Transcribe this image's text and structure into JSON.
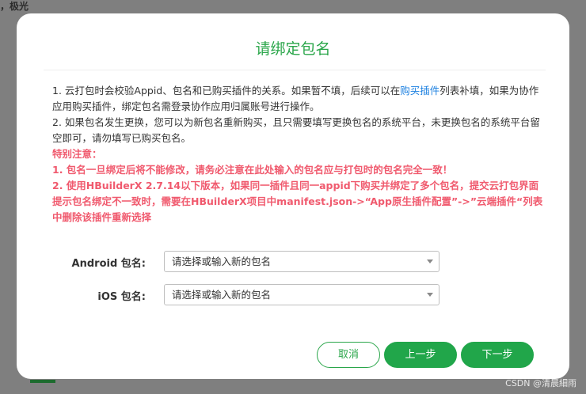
{
  "background": {
    "corner_text": "，极光",
    "watermark": "CSDN @清晨細雨"
  },
  "dialog": {
    "title": "请绑定包名",
    "notice": {
      "line1_pre": "1. 云打包时会校验Appid、包名和已购买插件的关系。如果暂不填，后续可以在",
      "line1_link": "购买插件",
      "line1_post": "列表补填，如果为协作应用购买插件，绑定包名需登录协作应用归属账号进行操作。",
      "line2": "2. 如果包名发生更换，您可以为新包名重新购买，且只需要填写更换包名的系统平台，未更换包名的系统平台留空即可，请勿填写已购买包名。",
      "warn_title": "特别注意：",
      "warn1": "1. 包名一旦绑定后将不能修改，请务必注意在此处输入的包名应与打包时的包名完全一致！",
      "warn2": "2. 使用HBuilderX 2.7.14以下版本，如果同一插件且同一appid下购买并绑定了多个包名，提交云打包界面提示包名绑定不一致时，需要在HBuilderX项目中manifest.json->“App原生插件配置”->”云端插件“列表中删除该插件重新选择"
    },
    "form": {
      "android_label": "Android 包名:",
      "android_value": "请选择或输入新的包名",
      "ios_label": "iOS 包名:",
      "ios_value": "请选择或输入新的包名"
    },
    "buttons": {
      "cancel": "取消",
      "prev": "上一步",
      "next": "下一步"
    }
  },
  "colors": {
    "accent": "#21a64a",
    "link": "#1a7fe0",
    "warning": "#f05a6e"
  }
}
